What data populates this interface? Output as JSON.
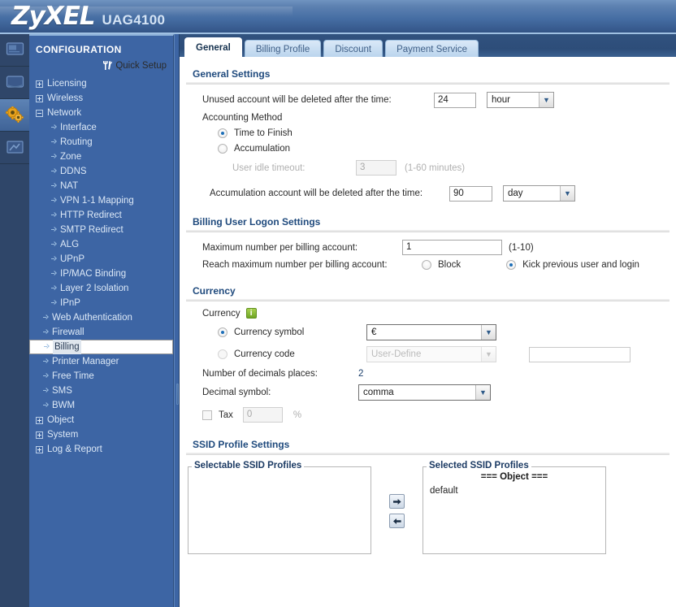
{
  "banner": {
    "logo": "ZyXEL",
    "model": "UAG4100"
  },
  "rail": {
    "items": [
      {
        "name": "monitor-icon",
        "label": "Monitor",
        "active": false
      },
      {
        "name": "dashboard-icon",
        "label": "Dashboard",
        "active": false
      },
      {
        "name": "configuration-gear-icon",
        "label": "Configuration",
        "active": true
      },
      {
        "name": "maintenance-icon",
        "label": "Maintenance",
        "active": false
      }
    ]
  },
  "sidebar": {
    "title": "CONFIGURATION",
    "quick_setup": "Quick Setup",
    "items": [
      {
        "label": "Licensing",
        "level": 1,
        "toggle": "plus",
        "selected": false
      },
      {
        "label": "Wireless",
        "level": 1,
        "toggle": "plus",
        "selected": false
      },
      {
        "label": "Network",
        "level": 1,
        "toggle": "minus",
        "selected": false
      },
      {
        "label": "Interface",
        "level": 2,
        "toggle": "dot",
        "selected": false
      },
      {
        "label": "Routing",
        "level": 2,
        "toggle": "dot",
        "selected": false
      },
      {
        "label": "Zone",
        "level": 2,
        "toggle": "dot",
        "selected": false
      },
      {
        "label": "DDNS",
        "level": 2,
        "toggle": "dot",
        "selected": false
      },
      {
        "label": "NAT",
        "level": 2,
        "toggle": "dot",
        "selected": false
      },
      {
        "label": "VPN 1-1 Mapping",
        "level": 2,
        "toggle": "dot",
        "selected": false
      },
      {
        "label": "HTTP Redirect",
        "level": 2,
        "toggle": "dot",
        "selected": false
      },
      {
        "label": "SMTP Redirect",
        "level": 2,
        "toggle": "dot",
        "selected": false
      },
      {
        "label": "ALG",
        "level": 2,
        "toggle": "dot",
        "selected": false
      },
      {
        "label": "UPnP",
        "level": 2,
        "toggle": "dot",
        "selected": false
      },
      {
        "label": "IP/MAC Binding",
        "level": 2,
        "toggle": "dot",
        "selected": false
      },
      {
        "label": "Layer 2 Isolation",
        "level": 2,
        "toggle": "dot",
        "selected": false
      },
      {
        "label": "IPnP",
        "level": 2,
        "toggle": "dot",
        "selected": false
      },
      {
        "label": "Web Authentication",
        "level": "1b",
        "toggle": "dot",
        "selected": false
      },
      {
        "label": "Firewall",
        "level": "1b",
        "toggle": "dot",
        "selected": false
      },
      {
        "label": "Billing",
        "level": "1b",
        "toggle": "dot",
        "selected": true
      },
      {
        "label": "Printer Manager",
        "level": "1b",
        "toggle": "dot",
        "selected": false
      },
      {
        "label": "Free Time",
        "level": "1b",
        "toggle": "dot",
        "selected": false
      },
      {
        "label": "SMS",
        "level": "1b",
        "toggle": "dot",
        "selected": false
      },
      {
        "label": "BWM",
        "level": "1b",
        "toggle": "dot",
        "selected": false
      },
      {
        "label": "Object",
        "level": 1,
        "toggle": "plus",
        "selected": false
      },
      {
        "label": "System",
        "level": 1,
        "toggle": "plus",
        "selected": false
      },
      {
        "label": "Log & Report",
        "level": 1,
        "toggle": "plus",
        "selected": false
      }
    ]
  },
  "tabs": [
    {
      "label": "General",
      "active": true
    },
    {
      "label": "Billing Profile",
      "active": false
    },
    {
      "label": "Discount",
      "active": false
    },
    {
      "label": "Payment Service",
      "active": false
    }
  ],
  "general_settings": {
    "heading": "General Settings",
    "unused_label": "Unused account will be deleted after the time:",
    "unused_value": "24",
    "unused_unit": "hour",
    "accounting_method_label": "Accounting Method",
    "time_to_finish": "Time to Finish",
    "time_to_finish_selected": true,
    "accumulation": "Accumulation",
    "accumulation_selected": false,
    "idle_label": "User idle timeout:",
    "idle_value": "3",
    "idle_range": "(1-60 minutes)",
    "accum_delete_label": "Accumulation account will be deleted after the time:",
    "accum_delete_value": "90",
    "accum_delete_unit": "day"
  },
  "billing_logon": {
    "heading": "Billing User Logon Settings",
    "max_label": "Maximum number per billing account:",
    "max_value": "1",
    "max_range": "(1-10)",
    "reach_label": "Reach maximum number per billing account:",
    "block_label": "Block",
    "block_selected": false,
    "kick_label": "Kick previous user and login",
    "kick_selected": true
  },
  "currency": {
    "heading": "Currency",
    "group_label": "Currency",
    "info_icon": "info-icon",
    "symbol_label": "Currency symbol",
    "symbol_selected": true,
    "symbol_value": "€",
    "code_label": "Currency code",
    "code_selected": false,
    "code_value": "User-Define",
    "code_text_value": "",
    "decimals_label": "Number of decimals places:",
    "decimals_value": "2",
    "decimal_symbol_label": "Decimal symbol:",
    "decimal_symbol_value": "comma",
    "tax_label": "Tax",
    "tax_checked": false,
    "tax_value": "0",
    "tax_unit": "%"
  },
  "ssid": {
    "heading": "SSID Profile Settings",
    "selectable_legend": "Selectable SSID Profiles",
    "selectable_items": [],
    "selected_legend": "Selected SSID Profiles",
    "object_header": "=== Object ===",
    "selected_items": [
      "default"
    ],
    "add_button": "➜",
    "remove_button": "➜"
  },
  "colors": {
    "banner_top": "#6f93c0",
    "banner_bottom": "#2f4f80",
    "sidebar": "#3d65a4",
    "rail": "#2f4669",
    "section_heading": "#1f4a7d",
    "radio_accent": "#1d6fb8",
    "info_green": "#6fa524",
    "selected_item_bg": "#dfe6ee"
  }
}
